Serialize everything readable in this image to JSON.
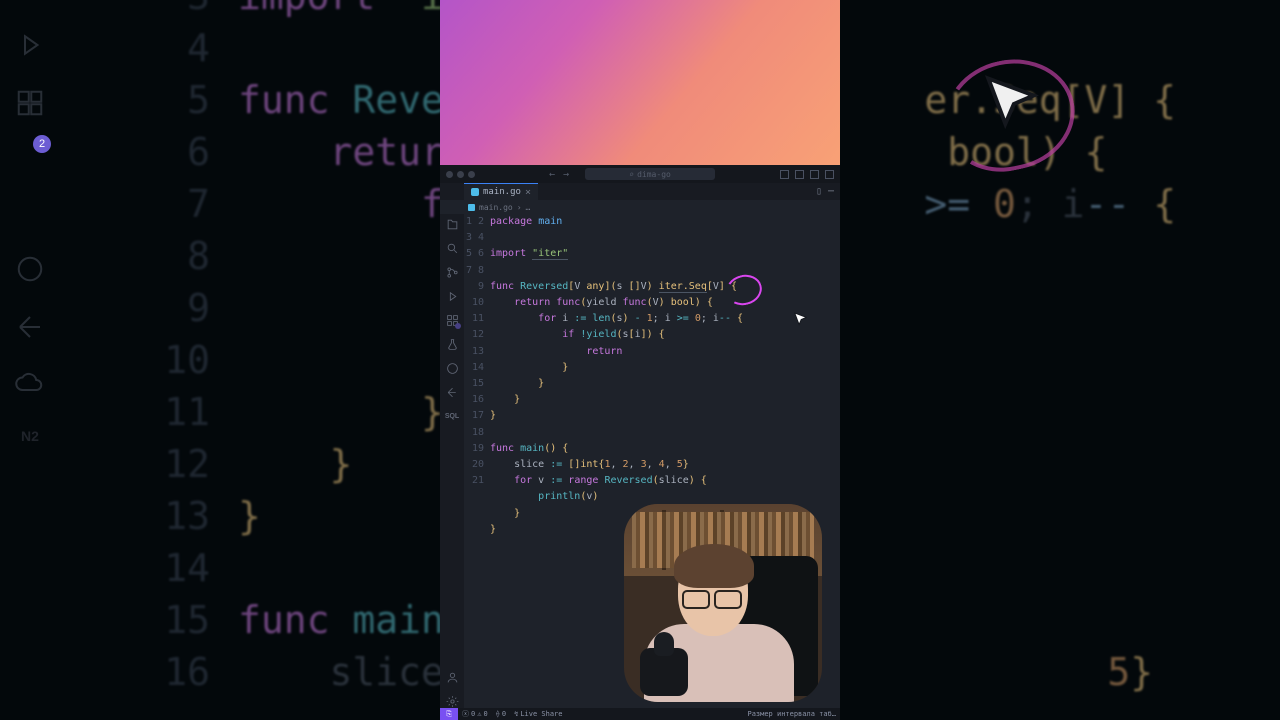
{
  "window": {
    "search_placeholder": "dima-go"
  },
  "tab": {
    "filename": "main.go"
  },
  "breadcrumb": {
    "file": "main.go"
  },
  "sidebar_badge": "2",
  "statusbar": {
    "errors": "0",
    "warnings": "0",
    "ports": "0",
    "liveshare": "Live Share",
    "extra": "Размер интервала таб…"
  },
  "code": {
    "lines": [
      {
        "n": 1,
        "seg": [
          [
            "kw",
            "package"
          ],
          [
            "id",
            " "
          ],
          [
            "bl",
            "main"
          ]
        ]
      },
      {
        "n": 2,
        "seg": []
      },
      {
        "n": 3,
        "seg": [
          [
            "kw",
            "import"
          ],
          [
            "id",
            " "
          ],
          [
            "st",
            "\"iter\""
          ]
        ]
      },
      {
        "n": 4,
        "seg": []
      },
      {
        "n": 5,
        "seg": [
          [
            "kw",
            "func"
          ],
          [
            "id",
            " "
          ],
          [
            "fn",
            "Reversed"
          ],
          [
            "br",
            "["
          ],
          [
            "id",
            "V "
          ],
          [
            "ty",
            "any"
          ],
          [
            "br",
            "]"
          ],
          [
            "br",
            "("
          ],
          [
            "id",
            "s "
          ],
          [
            "br",
            "[]"
          ],
          [
            "id",
            "V"
          ],
          [
            "br",
            ") "
          ],
          [
            "ty",
            "iter.Seq"
          ],
          [
            "br",
            "["
          ],
          [
            "id",
            "V"
          ],
          [
            "br",
            "] {"
          ]
        ]
      },
      {
        "n": 6,
        "seg": [
          [
            "id",
            "    "
          ],
          [
            "kw",
            "return"
          ],
          [
            "id",
            " "
          ],
          [
            "kw",
            "func"
          ],
          [
            "br",
            "("
          ],
          [
            "id",
            "yield "
          ],
          [
            "kw",
            "func"
          ],
          [
            "br",
            "("
          ],
          [
            "id",
            "V"
          ],
          [
            "br",
            ") "
          ],
          [
            "ty",
            "bool"
          ],
          [
            "br",
            ") {"
          ]
        ]
      },
      {
        "n": 7,
        "seg": [
          [
            "id",
            "        "
          ],
          [
            "kw",
            "for"
          ],
          [
            "id",
            " i "
          ],
          [
            "pc",
            ":="
          ],
          [
            "id",
            " "
          ],
          [
            "fn",
            "len"
          ],
          [
            "br",
            "("
          ],
          [
            "id",
            "s"
          ],
          [
            "br",
            ")"
          ],
          [
            "id",
            " "
          ],
          [
            "pc",
            "-"
          ],
          [
            "id",
            " "
          ],
          [
            "nm",
            "1"
          ],
          [
            "id",
            "; i "
          ],
          [
            "pc",
            ">="
          ],
          [
            "id",
            " "
          ],
          [
            "nm",
            "0"
          ],
          [
            "id",
            "; i"
          ],
          [
            "pc",
            "--"
          ],
          [
            "id",
            " "
          ],
          [
            "br",
            "{"
          ]
        ]
      },
      {
        "n": 8,
        "seg": [
          [
            "id",
            "            "
          ],
          [
            "kw",
            "if"
          ],
          [
            "id",
            " "
          ],
          [
            "pc",
            "!"
          ],
          [
            "fn",
            "yield"
          ],
          [
            "br",
            "("
          ],
          [
            "id",
            "s"
          ],
          [
            "br",
            "["
          ],
          [
            "id",
            "i"
          ],
          [
            "br",
            "]) {"
          ]
        ]
      },
      {
        "n": 9,
        "seg": [
          [
            "id",
            "                "
          ],
          [
            "kw",
            "return"
          ]
        ]
      },
      {
        "n": 10,
        "seg": [
          [
            "id",
            "            "
          ],
          [
            "br",
            "}"
          ]
        ]
      },
      {
        "n": 11,
        "seg": [
          [
            "id",
            "        "
          ],
          [
            "br",
            "}"
          ]
        ]
      },
      {
        "n": 12,
        "seg": [
          [
            "id",
            "    "
          ],
          [
            "br",
            "}"
          ]
        ]
      },
      {
        "n": 13,
        "seg": [
          [
            "br",
            "}"
          ]
        ]
      },
      {
        "n": 14,
        "seg": []
      },
      {
        "n": 15,
        "seg": [
          [
            "kw",
            "func"
          ],
          [
            "id",
            " "
          ],
          [
            "fn",
            "main"
          ],
          [
            "br",
            "() {"
          ]
        ]
      },
      {
        "n": 16,
        "seg": [
          [
            "id",
            "    slice "
          ],
          [
            "pc",
            ":="
          ],
          [
            "id",
            " "
          ],
          [
            "br",
            "[]"
          ],
          [
            "ty",
            "int"
          ],
          [
            "br",
            "{"
          ],
          [
            "nm",
            "1"
          ],
          [
            "id",
            ", "
          ],
          [
            "nm",
            "2"
          ],
          [
            "id",
            ", "
          ],
          [
            "nm",
            "3"
          ],
          [
            "id",
            ", "
          ],
          [
            "nm",
            "4"
          ],
          [
            "id",
            ", "
          ],
          [
            "nm",
            "5"
          ],
          [
            "br",
            "}"
          ]
        ]
      },
      {
        "n": 17,
        "seg": [
          [
            "id",
            "    "
          ],
          [
            "kw",
            "for"
          ],
          [
            "id",
            " v "
          ],
          [
            "pc",
            ":="
          ],
          [
            "id",
            " "
          ],
          [
            "kw",
            "range"
          ],
          [
            "id",
            " "
          ],
          [
            "fn",
            "Reversed"
          ],
          [
            "br",
            "("
          ],
          [
            "id",
            "slice"
          ],
          [
            "br",
            ") {"
          ]
        ]
      },
      {
        "n": 18,
        "seg": [
          [
            "id",
            "        "
          ],
          [
            "fn",
            "println"
          ],
          [
            "br",
            "("
          ],
          [
            "id",
            "v"
          ],
          [
            "br",
            ")"
          ]
        ]
      },
      {
        "n": 19,
        "seg": [
          [
            "id",
            "    "
          ],
          [
            "br",
            "}"
          ]
        ]
      },
      {
        "n": 20,
        "seg": [
          [
            "br",
            "}"
          ]
        ]
      },
      {
        "n": 21,
        "seg": []
      }
    ]
  },
  "bg_code": {
    "lines": [
      {
        "n": 3,
        "html": "<span class='kw'>import</span> <span class='st'>\"ite</span>"
      },
      {
        "n": 4,
        "html": ""
      },
      {
        "n": 5,
        "html": "<span class='kw'>func</span> <span class='fn'>Revers</span>                   <span class='ty'>er.Seq</span><span class='br'>[V] {</span>"
      },
      {
        "n": 6,
        "html": "    <span class='kw'>return</span>                     <span class='ty'>bool</span><span class='br'>) {</span>"
      },
      {
        "n": 7,
        "html": "        <span class='kw'>fo</span>                    <span class='op'>>=</span> <span class='nm'>0</span>; i<span class='op'>--</span> <span class='br'>{</span>"
      },
      {
        "n": 8,
        "html": ""
      },
      {
        "n": 9,
        "html": ""
      },
      {
        "n": 10,
        "html": "            <span class='br'>}</span>"
      },
      {
        "n": 11,
        "html": "        <span class='br'>}</span>"
      },
      {
        "n": 12,
        "html": "    <span class='br'>}</span>"
      },
      {
        "n": 13,
        "html": "<span class='br'>}</span>"
      },
      {
        "n": 14,
        "html": ""
      },
      {
        "n": 15,
        "html": "<span class='kw'>func</span> <span class='fn'>main</span><span class='br'>()</span>"
      },
      {
        "n": 16,
        "html": "    slice <span class='op'>:</span>                           <span class='nm'>5</span><span class='br'>}</span>"
      }
    ]
  }
}
